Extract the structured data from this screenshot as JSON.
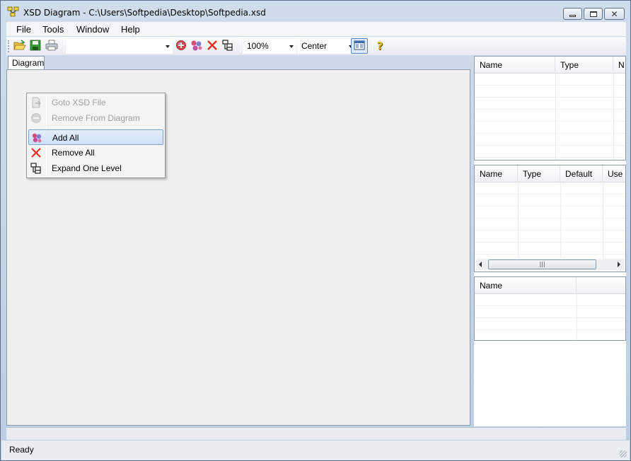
{
  "window": {
    "title": "XSD Diagram - C:\\Users\\Softpedia\\Desktop\\Softpedia.xsd"
  },
  "menu": {
    "file": "File",
    "tools": "Tools",
    "window": "Window",
    "help": "Help"
  },
  "toolbar": {
    "element_combo_value": "",
    "zoom_value": "100%",
    "alignment_value": "Center",
    "icons": [
      "open-icon",
      "save-icon",
      "print-icon",
      "add-icon",
      "add-all-icon",
      "remove-all-icon",
      "expand-one-level-icon",
      "layout-view-icon",
      "help-icon"
    ]
  },
  "tabs": {
    "diagram": "Diagram"
  },
  "context_menu": {
    "items": [
      {
        "label": "Goto XSD File",
        "enabled": false,
        "icon": "goto-file-icon"
      },
      {
        "label": "Remove From Diagram",
        "enabled": false,
        "icon": "remove-from-diagram-icon"
      },
      {
        "label": "Add All",
        "enabled": true,
        "highlighted": true,
        "icon": "add-all-icon"
      },
      {
        "label": "Remove All",
        "enabled": true,
        "icon": "remove-all-icon"
      },
      {
        "label": "Expand One Level",
        "enabled": true,
        "icon": "expand-one-level-icon"
      }
    ]
  },
  "panels": {
    "properties": {
      "columns": [
        "Name",
        "Type",
        "N"
      ]
    },
    "attributes": {
      "columns": [
        "Name",
        "Type",
        "Default",
        "Use"
      ]
    },
    "enumerations": {
      "columns": [
        "Name"
      ]
    }
  },
  "status": {
    "text": "Ready"
  },
  "colors": {
    "frame": "#c9d6e6",
    "highlight": "#cde0f8",
    "disabled_text": "#a1a1a1"
  }
}
